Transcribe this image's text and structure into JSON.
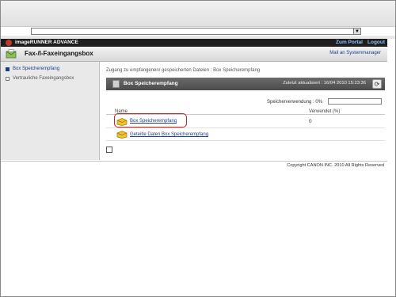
{
  "browser": {
    "address_value": "",
    "dropdown_glyph": "▼"
  },
  "brandbar": {
    "title": "imageRUNNER ADVANCE",
    "portal_link": "Zum Portal",
    "logout_link": "Logout"
  },
  "app": {
    "title": "Fax-/I-Faxeingangsbox",
    "system_manager": "Mail an Systemmanager"
  },
  "sidebar": {
    "items": [
      {
        "label": "Box Speicherempfang",
        "active": true
      },
      {
        "label": "Vertrauliche Faxeingangsbox",
        "active": false
      }
    ]
  },
  "main": {
    "breadcrumb": "Zugang zu empfangenen/ gespeicherten Dateien : Box Speicherempfang",
    "panel_title": "Box Speicherempfang",
    "last_updated": "Zuletzt aktualisiert : 16/04 2010 15:23:36",
    "usage_label": "Speicherverwendung : 0%",
    "usage_fraction": 0,
    "columns": {
      "name": "Name",
      "used": "Verwendet (%)"
    },
    "rows": [
      {
        "name": "Box Speicherempfang",
        "used": "0"
      },
      {
        "name": "Geteilte Daten Box Speicherempfang",
        "used": ""
      }
    ]
  },
  "footer": {
    "copyright": "Copyright CANON INC. 2010 All Rights Reserved"
  },
  "colors": {
    "accent": "#1a3e8b",
    "highlight": "#d01c1c",
    "brandbar": "#1e1e1e"
  }
}
